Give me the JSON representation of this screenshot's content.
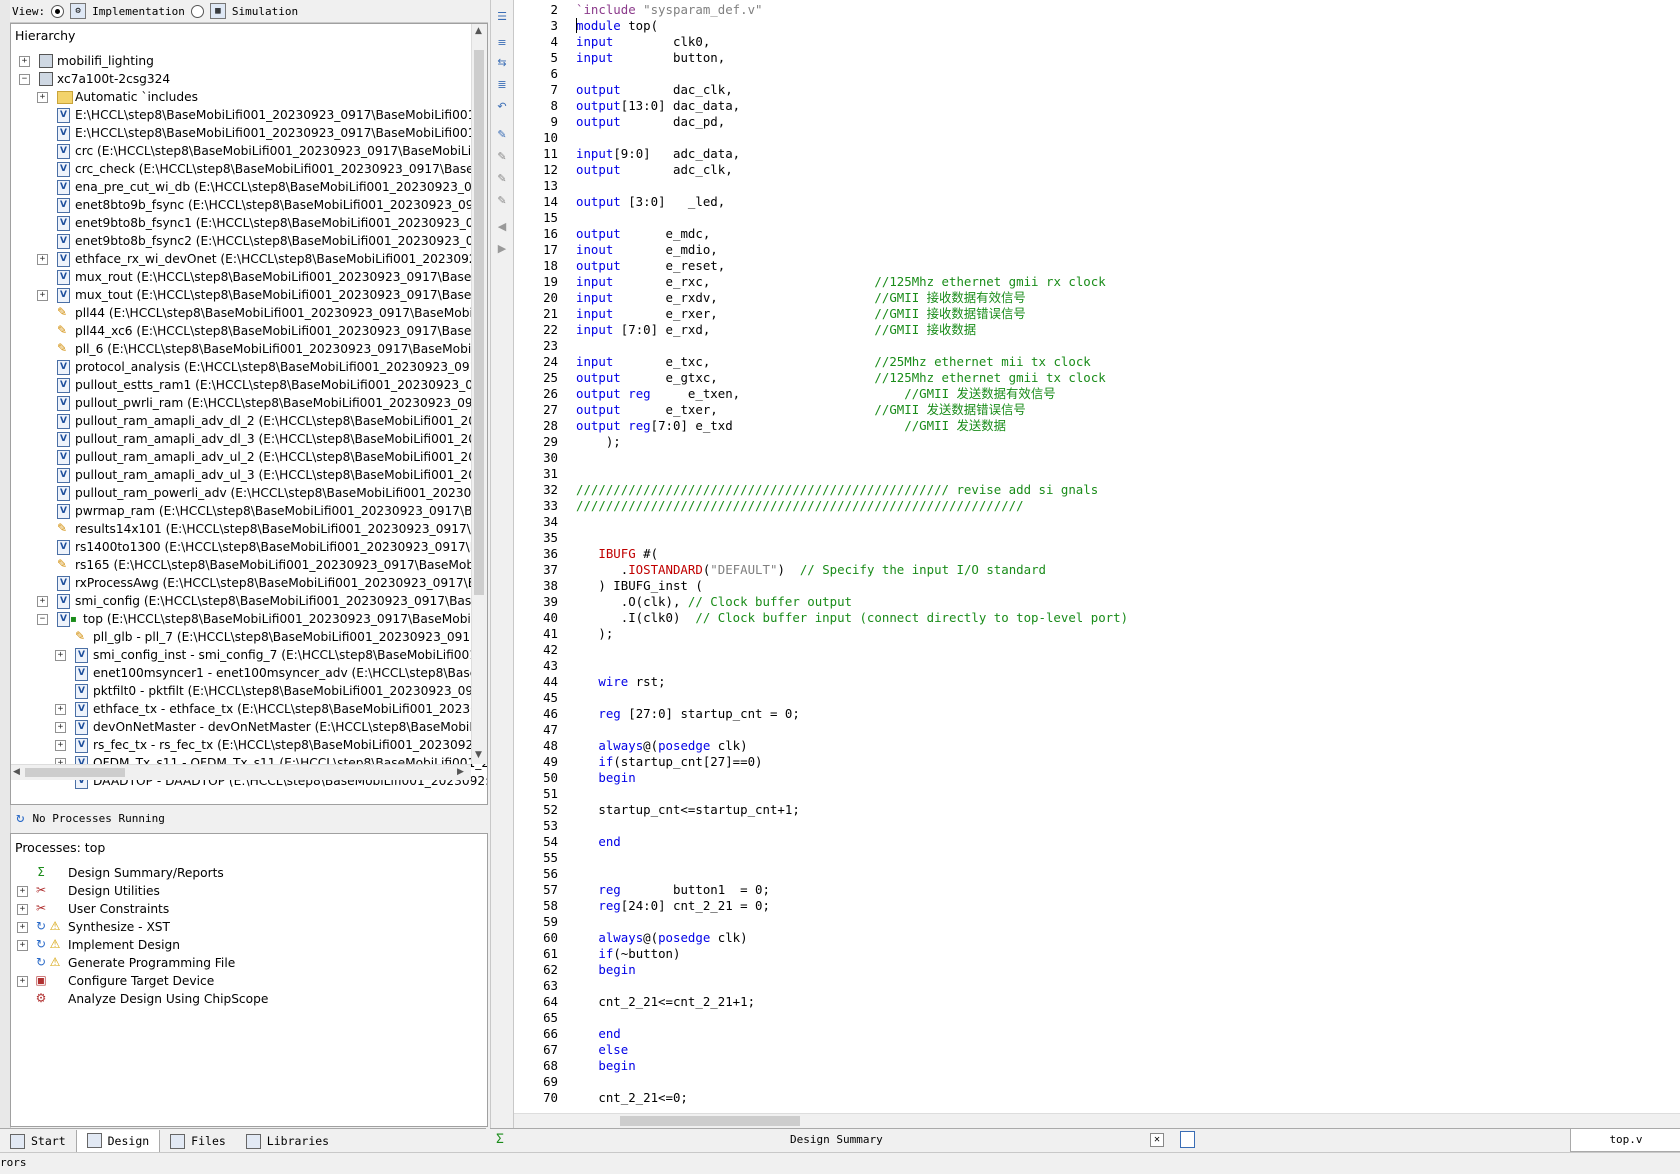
{
  "view_bar": {
    "label": "View:",
    "options": [
      {
        "label": "Implementation",
        "selected": true
      },
      {
        "label": "Simulation",
        "selected": false
      }
    ]
  },
  "hierarchy": {
    "title": "Hierarchy",
    "rows": [
      {
        "indent": 0,
        "expander": "+",
        "icon": "chip",
        "label": "mobilifi_lighting"
      },
      {
        "indent": 0,
        "expander": "-",
        "icon": "chip",
        "label": "xc7a100t-2csg324"
      },
      {
        "indent": 1,
        "expander": "+",
        "icon": "folder",
        "label": "Automatic `includes"
      },
      {
        "indent": 1,
        "expander": "",
        "icon": "v",
        "label": "E:\\HCCL\\step8\\BaseMobiLifi001_20230923_0917\\BaseMobiLifi001_2("
      },
      {
        "indent": 1,
        "expander": "",
        "icon": "v",
        "label": "E:\\HCCL\\step8\\BaseMobiLifi001_20230923_0917\\BaseMobiLifi001_2("
      },
      {
        "indent": 1,
        "expander": "",
        "icon": "v",
        "label": "crc (E:\\HCCL\\step8\\BaseMobiLifi001_20230923_0917\\BaseMobiLifi00"
      },
      {
        "indent": 1,
        "expander": "",
        "icon": "v",
        "label": "crc_check (E:\\HCCL\\step8\\BaseMobiLifi001_20230923_0917\\BaseMo"
      },
      {
        "indent": 1,
        "expander": "",
        "icon": "v",
        "label": "ena_pre_cut_wi_db (E:\\HCCL\\step8\\BaseMobiLifi001_20230923_0917"
      },
      {
        "indent": 1,
        "expander": "",
        "icon": "v",
        "label": "enet8bto9b_fsync (E:\\HCCL\\step8\\BaseMobiLifi001_20230923_0917\\"
      },
      {
        "indent": 1,
        "expander": "",
        "icon": "v",
        "label": "enet9bto8b_fsync1 (E:\\HCCL\\step8\\BaseMobiLifi001_20230923_0917"
      },
      {
        "indent": 1,
        "expander": "",
        "icon": "v",
        "label": "enet9bto8b_fsync2 (E:\\HCCL\\step8\\BaseMobiLifi001_20230923_0917"
      },
      {
        "indent": 1,
        "expander": "+",
        "icon": "v",
        "label": "ethface_rx_wi_devOnet (E:\\HCCL\\step8\\BaseMobiLifi001_20230923_C"
      },
      {
        "indent": 1,
        "expander": "",
        "icon": "v",
        "label": "mux_rout (E:\\HCCL\\step8\\BaseMobiLifi001_20230923_0917\\BaseMo"
      },
      {
        "indent": 1,
        "expander": "+",
        "icon": "v",
        "label": "mux_tout (E:\\HCCL\\step8\\BaseMobiLifi001_20230923_0917\\BaseMol"
      },
      {
        "indent": 1,
        "expander": "",
        "icon": "pll",
        "label": "pll44 (E:\\HCCL\\step8\\BaseMobiLifi001_20230923_0917\\BaseMobiLifi"
      },
      {
        "indent": 1,
        "expander": "",
        "icon": "pll",
        "label": "pll44_xc6 (E:\\HCCL\\step8\\BaseMobiLifi001_20230923_0917\\BaseMol"
      },
      {
        "indent": 1,
        "expander": "",
        "icon": "pll",
        "label": "pll_6 (E:\\HCCL\\step8\\BaseMobiLifi001_20230923_0917\\BaseMobiLifi"
      },
      {
        "indent": 1,
        "expander": "",
        "icon": "v",
        "label": "protocol_analysis (E:\\HCCL\\step8\\BaseMobiLifi001_20230923_0917\\"
      },
      {
        "indent": 1,
        "expander": "",
        "icon": "v",
        "label": "pullout_estts_ram1 (E:\\HCCL\\step8\\BaseMobiLifi001_20230923_0917"
      },
      {
        "indent": 1,
        "expander": "",
        "icon": "v",
        "label": "pullout_pwrli_ram (E:\\HCCL\\step8\\BaseMobiLifi001_20230923_0917\\"
      },
      {
        "indent": 1,
        "expander": "",
        "icon": "v",
        "label": "pullout_ram_amapli_adv_dl_2 (E:\\HCCL\\step8\\BaseMobiLifi001_2023("
      },
      {
        "indent": 1,
        "expander": "",
        "icon": "v",
        "label": "pullout_ram_amapli_adv_dl_3 (E:\\HCCL\\step8\\BaseMobiLifi001_2023("
      },
      {
        "indent": 1,
        "expander": "",
        "icon": "v",
        "label": "pullout_ram_amapli_adv_ul_2 (E:\\HCCL\\step8\\BaseMobiLifi001_2023("
      },
      {
        "indent": 1,
        "expander": "",
        "icon": "v",
        "label": "pullout_ram_amapli_adv_ul_3 (E:\\HCCL\\step8\\BaseMobiLifi001_2023("
      },
      {
        "indent": 1,
        "expander": "",
        "icon": "v",
        "label": "pullout_ram_powerli_adv (E:\\HCCL\\step8\\BaseMobiLifi001_20230923"
      },
      {
        "indent": 1,
        "expander": "",
        "icon": "v",
        "label": "pwrmap_ram (E:\\HCCL\\step8\\BaseMobiLifi001_20230923_0917\\Base"
      },
      {
        "indent": 1,
        "expander": "",
        "icon": "pll",
        "label": "results14x101 (E:\\HCCL\\step8\\BaseMobiLifi001_20230923_0917\\Bas"
      },
      {
        "indent": 1,
        "expander": "",
        "icon": "v",
        "label": "rs1400to1300 (E:\\HCCL\\step8\\BaseMobiLifi001_20230923_0917\\Bas"
      },
      {
        "indent": 1,
        "expander": "",
        "icon": "pll",
        "label": "rs165 (E:\\HCCL\\step8\\BaseMobiLifi001_20230923_0917\\BaseMobiLi"
      },
      {
        "indent": 1,
        "expander": "",
        "icon": "v",
        "label": "rxProcessAwg (E:\\HCCL\\step8\\BaseMobiLifi001_20230923_0917\\Bas"
      },
      {
        "indent": 1,
        "expander": "+",
        "icon": "v",
        "label": "smi_config (E:\\HCCL\\step8\\BaseMobiLifi001_20230923_0917\\BaseM"
      },
      {
        "indent": 1,
        "expander": "-",
        "icon": "vtop",
        "label": "top (E:\\HCCL\\step8\\BaseMobiLifi001_20230923_0917\\BaseMobiL"
      },
      {
        "indent": 2,
        "expander": "",
        "icon": "pll",
        "label": "pll_glb - pll_7 (E:\\HCCL\\step8\\BaseMobiLifi001_20230923_0917\\B"
      },
      {
        "indent": 2,
        "expander": "+",
        "icon": "v",
        "label": "smi_config_inst - smi_config_7 (E:\\HCCL\\step8\\BaseMobiLifi001_2"
      },
      {
        "indent": 2,
        "expander": "",
        "icon": "v",
        "label": "enet100msyncer1 - enet100msyncer_adv (E:\\HCCL\\step8\\BaseMo"
      },
      {
        "indent": 2,
        "expander": "",
        "icon": "v",
        "label": "pktfilt0 - pktfilt (E:\\HCCL\\step8\\BaseMobiLifi001_20230923_0917"
      },
      {
        "indent": 2,
        "expander": "+",
        "icon": "v",
        "label": "ethface_tx - ethface_tx (E:\\HCCL\\step8\\BaseMobiLifi001_2023092"
      },
      {
        "indent": 2,
        "expander": "+",
        "icon": "v",
        "label": "devOnNetMaster - devOnNetMaster (E:\\HCCL\\step8\\BaseMobiL"
      },
      {
        "indent": 2,
        "expander": "+",
        "icon": "v",
        "label": "rs_fec_tx - rs_fec_tx (E:\\HCCL\\step8\\BaseMobiLifi001_20230923_0"
      },
      {
        "indent": 2,
        "expander": "+",
        "icon": "v",
        "label": "OFDM_Tx_s11 - OFDM_Tx_s11 (E:\\HCCL\\step8\\BaseMobiLifi001_2"
      },
      {
        "indent": 2,
        "expander": "",
        "icon": "v",
        "label": "DAADTOP - DAADTOP (E:\\HCCL\\step8\\BaseMobiLifi001_2023092:"
      }
    ]
  },
  "process_status": "No Processes Running",
  "processes": {
    "title": "Processes: top",
    "rows": [
      {
        "expander": "",
        "icon": "Σ",
        "warn": false,
        "label": "Design Summary/Reports"
      },
      {
        "expander": "+",
        "icon": "✂",
        "warn": false,
        "label": "Design Utilities"
      },
      {
        "expander": "+",
        "icon": "✂",
        "warn": false,
        "label": "User Constraints"
      },
      {
        "expander": "+",
        "icon": "↻",
        "warn": true,
        "label": "Synthesize - XST"
      },
      {
        "expander": "+",
        "icon": "↻",
        "warn": true,
        "label": "Implement Design"
      },
      {
        "expander": "",
        "icon": "↻",
        "warn": true,
        "label": "Generate Programming File"
      },
      {
        "expander": "+",
        "icon": "▣",
        "warn": false,
        "label": "Configure Target Device"
      },
      {
        "expander": "",
        "icon": "⚙",
        "warn": false,
        "label": "Analyze Design Using ChipScope"
      }
    ]
  },
  "left_tabs": [
    {
      "label": "Start",
      "active": false
    },
    {
      "label": "Design",
      "active": true
    },
    {
      "label": "Files",
      "active": false
    },
    {
      "label": "Libraries",
      "active": false
    }
  ],
  "editor_tabs": {
    "design_summary": "Design Summary",
    "file": "top.v"
  },
  "status_text": "rors",
  "code_lines": [
    {
      "n": "2",
      "segs": [
        [
          "pp",
          "`include "
        ],
        [
          "st",
          "\"sysparam_def.v\""
        ]
      ]
    },
    {
      "n": "3",
      "segs": [
        [
          "kw",
          "module"
        ],
        [
          "",
          " top("
        ]
      ]
    },
    {
      "n": "4",
      "segs": [
        [
          "kw",
          "input"
        ],
        [
          "",
          "        clk0,"
        ]
      ]
    },
    {
      "n": "5",
      "segs": [
        [
          "kw",
          "input"
        ],
        [
          "",
          "        button,"
        ]
      ]
    },
    {
      "n": "6",
      "segs": []
    },
    {
      "n": "7",
      "segs": [
        [
          "kw",
          "output"
        ],
        [
          "",
          "       dac_clk,"
        ]
      ]
    },
    {
      "n": "8",
      "segs": [
        [
          "kw",
          "output"
        ],
        [
          "",
          "[13:0] dac_data,"
        ]
      ]
    },
    {
      "n": "9",
      "segs": [
        [
          "kw",
          "output"
        ],
        [
          "",
          "       dac_pd,"
        ]
      ]
    },
    {
      "n": "10",
      "segs": []
    },
    {
      "n": "11",
      "segs": [
        [
          "kw",
          "input"
        ],
        [
          "",
          "[9:0]   adc_data,"
        ]
      ]
    },
    {
      "n": "12",
      "segs": [
        [
          "kw",
          "output"
        ],
        [
          "",
          "       adc_clk,"
        ]
      ]
    },
    {
      "n": "13",
      "segs": []
    },
    {
      "n": "14",
      "segs": [
        [
          "kw",
          "output"
        ],
        [
          "",
          " [3:0]   _led,"
        ]
      ]
    },
    {
      "n": "15",
      "segs": []
    },
    {
      "n": "16",
      "segs": [
        [
          "kw",
          "output"
        ],
        [
          "",
          "      e_mdc,"
        ]
      ]
    },
    {
      "n": "17",
      "segs": [
        [
          "kw",
          "inout"
        ],
        [
          "",
          "       e_mdio,"
        ]
      ]
    },
    {
      "n": "18",
      "segs": [
        [
          "kw",
          "output"
        ],
        [
          "",
          "      e_reset,"
        ]
      ]
    },
    {
      "n": "19",
      "segs": [
        [
          "kw",
          "input"
        ],
        [
          "",
          "       e_rxc,                      "
        ],
        [
          "cm",
          "//125Mhz ethernet gmii rx clock"
        ]
      ]
    },
    {
      "n": "20",
      "segs": [
        [
          "kw",
          "input"
        ],
        [
          "",
          "       e_rxdv,                     "
        ],
        [
          "cm",
          "//GMII 接收数据有效信号"
        ]
      ]
    },
    {
      "n": "21",
      "segs": [
        [
          "kw",
          "input"
        ],
        [
          "",
          "       e_rxer,                     "
        ],
        [
          "cm",
          "//GMII 接收数据错误信号"
        ]
      ]
    },
    {
      "n": "22",
      "segs": [
        [
          "kw",
          "input"
        ],
        [
          "",
          " [7:0] e_rxd,                      "
        ],
        [
          "cm",
          "//GMII 接收数据"
        ]
      ]
    },
    {
      "n": "23",
      "segs": []
    },
    {
      "n": "24",
      "segs": [
        [
          "kw",
          "input"
        ],
        [
          "",
          "       e_txc,                      "
        ],
        [
          "cm",
          "//25Mhz ethernet mii tx clock"
        ]
      ]
    },
    {
      "n": "25",
      "segs": [
        [
          "kw",
          "output"
        ],
        [
          "",
          "      e_gtxc,                     "
        ],
        [
          "cm",
          "//125Mhz ethernet gmii tx clock"
        ]
      ]
    },
    {
      "n": "26",
      "segs": [
        [
          "kw",
          "output"
        ],
        [
          "",
          " "
        ],
        [
          "kw",
          "reg"
        ],
        [
          "",
          "     e_txen,                      "
        ],
        [
          "cm",
          "//GMII 发送数据有效信号"
        ]
      ]
    },
    {
      "n": "27",
      "segs": [
        [
          "kw",
          "output"
        ],
        [
          "",
          "      e_txer,                     "
        ],
        [
          "cm",
          "//GMII 发送数据错误信号"
        ]
      ]
    },
    {
      "n": "28",
      "segs": [
        [
          "kw",
          "output"
        ],
        [
          "",
          " "
        ],
        [
          "kw",
          "reg"
        ],
        [
          "",
          "[7:0] e_txd                       "
        ],
        [
          "cm",
          "//GMII 发送数据"
        ]
      ]
    },
    {
      "n": "29",
      "segs": [
        [
          "",
          "    );"
        ]
      ]
    },
    {
      "n": "30",
      "segs": []
    },
    {
      "n": "31",
      "segs": []
    },
    {
      "n": "32",
      "segs": [
        [
          "cm",
          "////////////////////////////////////////////////// revise add si gnals"
        ]
      ]
    },
    {
      "n": "33",
      "segs": [
        [
          "cm",
          "////////////////////////////////////////////////////////////"
        ]
      ]
    },
    {
      "n": "34",
      "segs": []
    },
    {
      "n": "35",
      "segs": []
    },
    {
      "n": "36",
      "segs": [
        [
          "",
          "   "
        ],
        [
          "rd",
          "IBUFG"
        ],
        [
          "",
          " #("
        ]
      ]
    },
    {
      "n": "37",
      "segs": [
        [
          "",
          "      ."
        ],
        [
          "rd",
          "IOSTANDARD"
        ],
        [
          "",
          "("
        ],
        [
          "st",
          "\"DEFAULT\""
        ],
        [
          "",
          ")  "
        ],
        [
          "cm",
          "// Specify the input I/O standard"
        ]
      ]
    },
    {
      "n": "38",
      "segs": [
        [
          "",
          "   ) IBUFG_inst ("
        ]
      ]
    },
    {
      "n": "39",
      "segs": [
        [
          "",
          "      .O(clk), "
        ],
        [
          "cm",
          "// Clock buffer output"
        ]
      ]
    },
    {
      "n": "40",
      "segs": [
        [
          "",
          "      .I(clk0)  "
        ],
        [
          "cm",
          "// Clock buffer input (connect directly to top-level port)"
        ]
      ]
    },
    {
      "n": "41",
      "segs": [
        [
          "",
          "   );"
        ]
      ]
    },
    {
      "n": "42",
      "segs": []
    },
    {
      "n": "43",
      "segs": []
    },
    {
      "n": "44",
      "segs": [
        [
          "",
          "   "
        ],
        [
          "kw",
          "wire"
        ],
        [
          "",
          " rst;"
        ]
      ]
    },
    {
      "n": "45",
      "segs": []
    },
    {
      "n": "46",
      "segs": [
        [
          "",
          "   "
        ],
        [
          "kw",
          "reg"
        ],
        [
          "",
          " [27:0] startup_cnt = 0;"
        ]
      ]
    },
    {
      "n": "47",
      "segs": []
    },
    {
      "n": "48",
      "segs": [
        [
          "",
          "   "
        ],
        [
          "kw",
          "always"
        ],
        [
          "",
          "@("
        ],
        [
          "kw",
          "posedge"
        ],
        [
          "",
          " clk)"
        ]
      ]
    },
    {
      "n": "49",
      "segs": [
        [
          "",
          "   "
        ],
        [
          "kw",
          "if"
        ],
        [
          "",
          "(startup_cnt[27]==0)"
        ]
      ]
    },
    {
      "n": "50",
      "segs": [
        [
          "",
          "   "
        ],
        [
          "kw",
          "begin"
        ]
      ]
    },
    {
      "n": "51",
      "segs": []
    },
    {
      "n": "52",
      "segs": [
        [
          "",
          "   startup_cnt<=startup_cnt+1;"
        ]
      ]
    },
    {
      "n": "53",
      "segs": []
    },
    {
      "n": "54",
      "segs": [
        [
          "",
          "   "
        ],
        [
          "kw",
          "end"
        ]
      ]
    },
    {
      "n": "55",
      "segs": []
    },
    {
      "n": "56",
      "segs": []
    },
    {
      "n": "57",
      "segs": [
        [
          "",
          "   "
        ],
        [
          "kw",
          "reg"
        ],
        [
          "",
          "       button1  = 0;"
        ]
      ]
    },
    {
      "n": "58",
      "segs": [
        [
          "",
          "   "
        ],
        [
          "kw",
          "reg"
        ],
        [
          "",
          "[24:0] cnt_2_21 = 0;"
        ]
      ]
    },
    {
      "n": "59",
      "segs": []
    },
    {
      "n": "60",
      "segs": [
        [
          "",
          "   "
        ],
        [
          "kw",
          "always"
        ],
        [
          "",
          "@("
        ],
        [
          "kw",
          "posedge"
        ],
        [
          "",
          " clk)"
        ]
      ]
    },
    {
      "n": "61",
      "segs": [
        [
          "",
          "   "
        ],
        [
          "kw",
          "if"
        ],
        [
          "",
          "(~button)"
        ]
      ]
    },
    {
      "n": "62",
      "segs": [
        [
          "",
          "   "
        ],
        [
          "kw",
          "begin"
        ]
      ]
    },
    {
      "n": "63",
      "segs": []
    },
    {
      "n": "64",
      "segs": [
        [
          "",
          "   cnt_2_21<=cnt_2_21+1;"
        ]
      ]
    },
    {
      "n": "65",
      "segs": []
    },
    {
      "n": "66",
      "segs": [
        [
          "",
          "   "
        ],
        [
          "kw",
          "end"
        ]
      ]
    },
    {
      "n": "67",
      "segs": [
        [
          "",
          "   "
        ],
        [
          "kw",
          "else"
        ]
      ]
    },
    {
      "n": "68",
      "segs": [
        [
          "",
          "   "
        ],
        [
          "kw",
          "begin"
        ]
      ]
    },
    {
      "n": "69",
      "segs": []
    },
    {
      "n": "70",
      "segs": [
        [
          "",
          "   cnt_2_21<=0;"
        ]
      ]
    }
  ]
}
